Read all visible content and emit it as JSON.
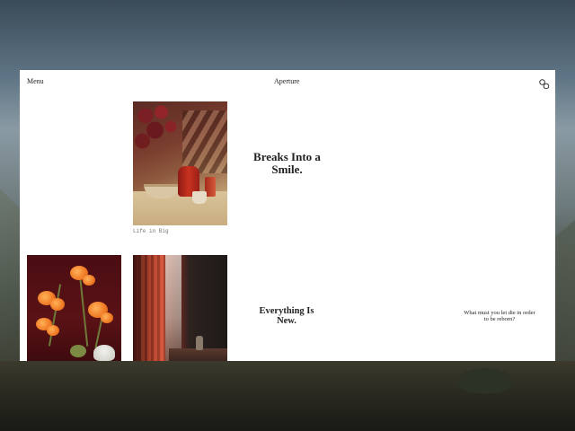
{
  "header": {
    "menu_label": "Menu",
    "brand": "Aperture",
    "link_icon": "link-icon"
  },
  "section_1": {
    "photo_alt": "still-life",
    "caption": "Life in Big",
    "heading": "Breaks Into a Smile."
  },
  "section_2": {
    "heading": "Everything Is New.",
    "quote": "What must you let die in order to be reborn?"
  },
  "colors": {
    "panel": "#ffffff",
    "text": "#222222",
    "caption": "#777777"
  }
}
